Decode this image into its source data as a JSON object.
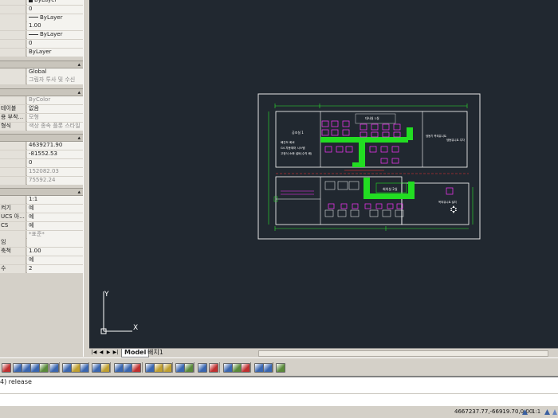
{
  "properties": {
    "general": [
      {
        "label": "",
        "value": "ByLayer",
        "kind": "square"
      },
      {
        "label": "",
        "value": "0",
        "kind": "text"
      },
      {
        "label": "",
        "value": "ByLayer",
        "kind": "line"
      },
      {
        "label": "",
        "value": "1.00",
        "kind": "text"
      },
      {
        "label": "",
        "value": "ByLayer",
        "kind": "line"
      },
      {
        "label": "",
        "value": "0",
        "kind": "text"
      },
      {
        "label": "",
        "value": "ByLayer",
        "kind": "text"
      }
    ],
    "view3d": [
      {
        "label": "",
        "value": "Global",
        "gray": false
      },
      {
        "label": "",
        "value": "그림자 투사 및 수신",
        "gray": true
      }
    ],
    "plot": [
      {
        "label": "",
        "value": "ByColor",
        "gray": true
      },
      {
        "label": "테이블",
        "value": "없음",
        "gray": false
      },
      {
        "label": "용 부착...",
        "value": "모형",
        "gray": true
      },
      {
        "label": "형식",
        "value": "색상 종속 플롯 스타일",
        "gray": true
      }
    ],
    "view": [
      {
        "label": "",
        "value": "4639271.90",
        "gray": false
      },
      {
        "label": "",
        "value": "-81552.53",
        "gray": false
      },
      {
        "label": "",
        "value": "0",
        "gray": false
      },
      {
        "label": "",
        "value": "152082.03",
        "gray": true
      },
      {
        "label": "",
        "value": "75592.24",
        "gray": true
      }
    ],
    "misc": [
      {
        "label": "",
        "value": "1:1",
        "gray": false
      },
      {
        "label": "켜기",
        "value": "예",
        "gray": false
      },
      {
        "label": "UCS 아...",
        "value": "예",
        "gray": false
      },
      {
        "label": "CS",
        "value": "예",
        "gray": false
      },
      {
        "label": "",
        "value": "*표준*",
        "gray": true
      },
      {
        "label": "임",
        "value": "",
        "gray": false
      },
      {
        "label": "축척",
        "value": "1.00",
        "gray": false
      },
      {
        "label": "",
        "value": "예",
        "gray": false
      },
      {
        "label": "수",
        "value": "2",
        "gray": false
      }
    ]
  },
  "drawing": {
    "room_label_top_left": "공조실 1",
    "room_label_top_right": "대사실 1실",
    "room_label_center": "회의실 2실",
    "notes_line1": "배관도 회로",
    "notes_line2": "G4 자동제어 시스템",
    "notes_line3": "고정식 소화 설비(수직 배)",
    "right_label": "냉동기 옥외유니트",
    "right_label2": "냉동유니트 주차",
    "bottom_right_label": "옥외유니트 설치"
  },
  "ucs": {
    "x_label": "X",
    "y_label": "Y"
  },
  "tabs": {
    "model": "Model",
    "layout1": "배치1"
  },
  "command": {
    "history": "4) release",
    "input": ""
  },
  "status": {
    "coordinates": "4667237.77,-66919.70,0.00",
    "scale": "1:1"
  },
  "colors": {
    "canvas": "#212830",
    "accent_green": "#22dd22",
    "wall": "#ffffff",
    "magenta": "#ff33ff"
  }
}
